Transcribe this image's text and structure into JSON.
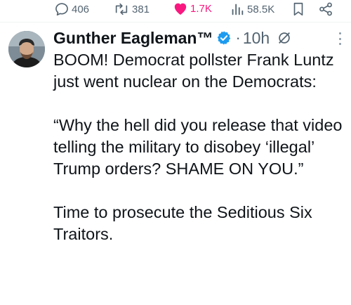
{
  "actions": {
    "replies": "406",
    "reposts": "381",
    "likes": "1.7K",
    "views": "58.5K",
    "like_color": "#f91880",
    "icons": [
      "reply-icon",
      "repost-icon",
      "heart-icon",
      "views-icon",
      "bookmark-icon",
      "share-icon"
    ]
  },
  "tweet": {
    "author": "Gunther Eagleman™",
    "separator": "·",
    "time": "10h",
    "verified_color": "#1d9bf0",
    "paragraphs": [
      "BOOM!  Democrat pollster Frank Luntz just went nuclear on the Democrats:",
      "“Why the hell did you release that video telling the military to disobey ‘illegal’ Trump orders?  SHAME ON YOU.”",
      "Time to prosecute the Seditious Six Traitors."
    ]
  }
}
